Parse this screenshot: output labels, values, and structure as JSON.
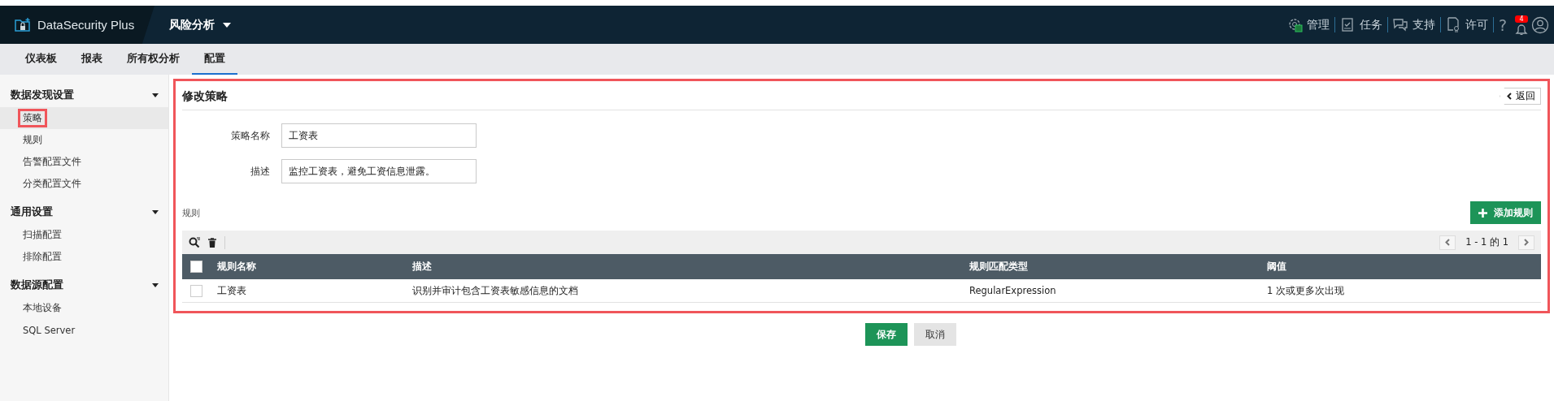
{
  "app": {
    "product": "DataSecurity Plus",
    "module": "风险分析"
  },
  "header_actions": [
    {
      "kind": "admin",
      "label": "管理"
    },
    {
      "kind": "tasks",
      "label": "任务"
    },
    {
      "kind": "support",
      "label": "支持"
    },
    {
      "kind": "license",
      "label": "许可"
    }
  ],
  "help": "?",
  "notifications": {
    "count": "4"
  },
  "tabs": [
    {
      "label": "仪表板",
      "selected": false
    },
    {
      "label": "报表",
      "selected": false
    },
    {
      "label": "所有权分析",
      "selected": false
    },
    {
      "label": "配置",
      "selected": true
    }
  ],
  "sidebar": {
    "sections": [
      {
        "title": "数据发现设置",
        "expanded": true,
        "items": [
          {
            "label": "策略",
            "selected": true,
            "highlighted": true
          },
          {
            "label": "规则",
            "selected": false,
            "highlighted": false
          },
          {
            "label": "告警配置文件",
            "selected": false,
            "highlighted": false
          },
          {
            "label": "分类配置文件",
            "selected": false,
            "highlighted": false
          }
        ]
      },
      {
        "title": "通用设置",
        "expanded": true,
        "items": [
          {
            "label": "扫描配置",
            "selected": false,
            "highlighted": false
          },
          {
            "label": "排除配置",
            "selected": false,
            "highlighted": false
          }
        ]
      },
      {
        "title": "数据源配置",
        "expanded": true,
        "items": [
          {
            "label": "本地设备",
            "selected": false,
            "highlighted": false
          },
          {
            "label": "SQL Server",
            "selected": false,
            "highlighted": false
          }
        ]
      }
    ]
  },
  "panel": {
    "title": "修改策略",
    "highlighted": true,
    "back_button": "返回",
    "fields": [
      {
        "label": "策略名称",
        "value": "工资表"
      },
      {
        "label": "描述",
        "value": "监控工资表，避免工资信息泄露。"
      }
    ],
    "rules_label": "规则",
    "add_button": "添加规则",
    "pagination": "1 - 1 的 1",
    "table": {
      "select_all": false,
      "columns": [
        "规则名称",
        "描述",
        "规则匹配类型",
        "阈值"
      ],
      "rows": [
        {
          "checked": false,
          "cells": [
            "工资表",
            "识别并审计包含工资表敏感信息的文档",
            "RegularExpression",
            "1 次或更多次出现"
          ]
        }
      ]
    }
  },
  "buttons": [
    {
      "kind": "primary",
      "label": "保存"
    },
    {
      "kind": "secondary",
      "label": "取消"
    }
  ]
}
